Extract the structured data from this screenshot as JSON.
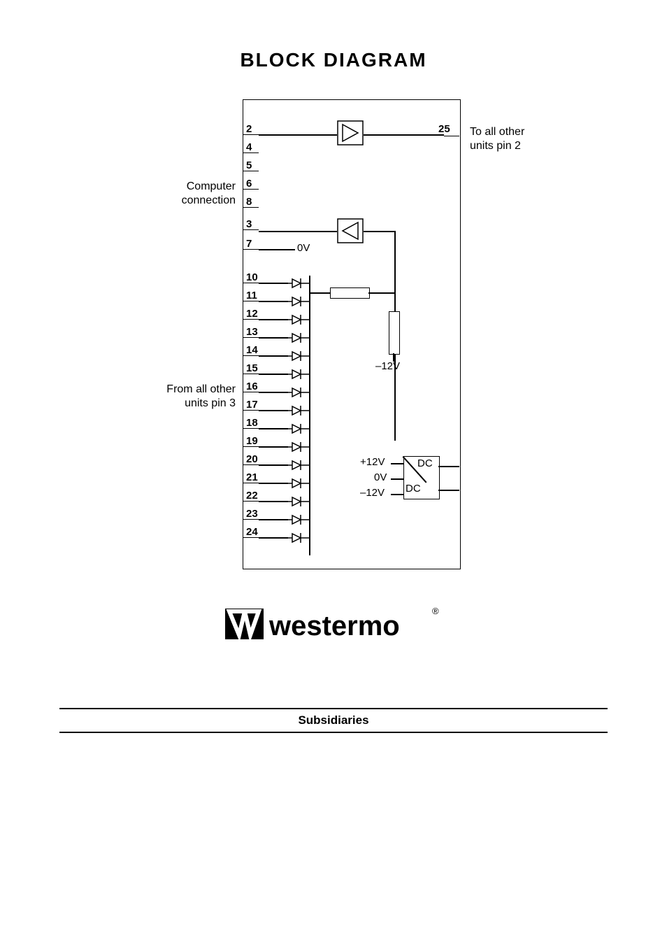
{
  "title": "BLOCK DIAGRAM",
  "labels": {
    "computer_connection": "Computer\nconnection",
    "from_all_other": "From all other\nunits pin 3",
    "to_all_other": "To all other\nunits pin 2",
    "zero_v": "0V",
    "minus_12v": "–12V",
    "ps_plus": "+12V",
    "ps_zero": "0V",
    "ps_minus": "–12V",
    "dc1": "DC",
    "dc2": "DC"
  },
  "pins_left_top": [
    "2",
    "4",
    "5",
    "6",
    "8",
    "3",
    "7"
  ],
  "pin_right": "25",
  "pins_left_bottom": [
    "10",
    "11",
    "12",
    "13",
    "14",
    "15",
    "16",
    "17",
    "18",
    "19",
    "20",
    "21",
    "22",
    "23",
    "24"
  ],
  "logo_text": "westermo",
  "logo_reg": "®",
  "section": "Subsidiaries"
}
